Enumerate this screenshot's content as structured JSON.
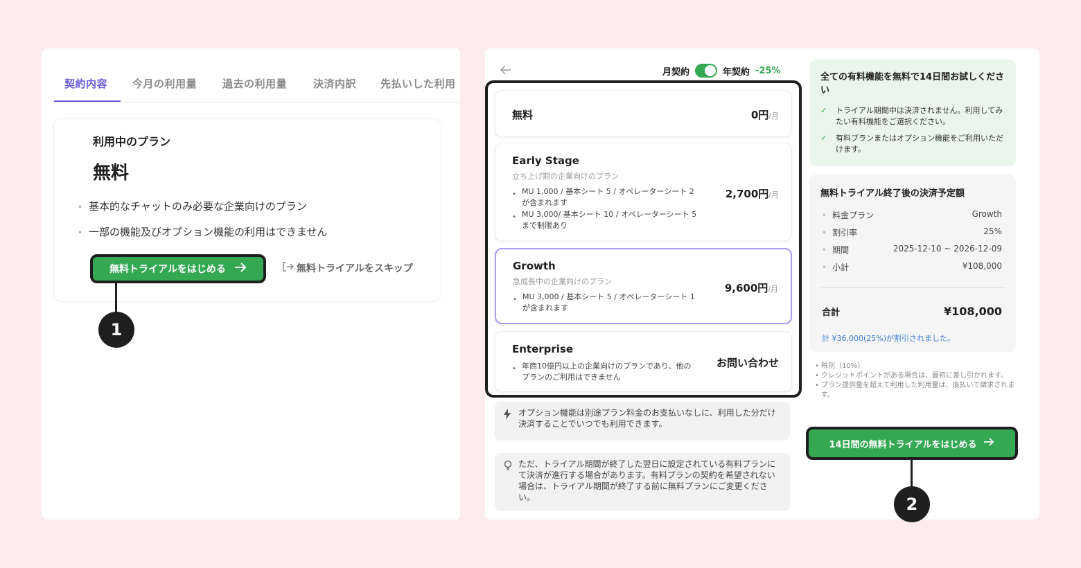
{
  "left": {
    "tabs": [
      "契約内容",
      "今月の利用量",
      "過去の利用量",
      "決済内訳",
      "先払いした利用"
    ],
    "plan_label": "利用中のプラン",
    "plan_name": "無料",
    "bullets": [
      "基本的なチャットのみ必要な企業向けのプラン",
      "一部の機能及びオプション機能の利用はできません"
    ],
    "trial_button": "無料トライアルをはじめる",
    "skip_button": "無料トライアルをスキップ",
    "callout": "1"
  },
  "right": {
    "billing": {
      "monthly": "月契約",
      "yearly": "年契約",
      "discount": "-25%"
    },
    "plans": [
      {
        "name": "無料",
        "price": "0円",
        "unit": "/月"
      },
      {
        "name": "Early Stage",
        "subtitle": "立ち上げ期の企業向けのプラン",
        "features": [
          "MU 1,000 / 基本シート 5 / オペレーターシート 2が含まれます",
          "MU 3,000/ 基本シート 10 / オペレーターシート 5まで制限あり"
        ],
        "price": "2,700円",
        "unit": "/月"
      },
      {
        "name": "Growth",
        "subtitle": "急成長中の企業向けのプラン",
        "features": [
          "MU 3,000 / 基本シート 5 / オペレーターシート 1が含まれます"
        ],
        "price": "9,600円",
        "unit": "/月"
      },
      {
        "name": "Enterprise",
        "features": [
          "年商10億円以上の企業向けのプランであり、他のプランのご利用はできません"
        ],
        "price": "お問い合わせ"
      }
    ],
    "option_info": "オプション機能は別途プラン料金のお支払いなしに、利用した分だけ決済することでいつでも利用できます。",
    "trial_info": "ただ、トライアル期間が終了した翌日に設定されている有料プランにて決済が進行する場合があります。有料プランの契約を希望されない場合は、トライアル期間が終了する前に無料プランにご変更ください。",
    "trial_box": {
      "title": "全ての有料機能を無料で14日間お試しください",
      "items": [
        "トライアル期間中は決済されません。利用してみたい有料機能をご選択ください。",
        "有料プランまたはオプション機能をご利用いただけます。"
      ]
    },
    "summary": {
      "title": "無料トライアル終了後の決済予定額",
      "rows": [
        {
          "k": "料金プラン",
          "v": "Growth"
        },
        {
          "k": "割引率",
          "v": "25%"
        },
        {
          "k": "期間",
          "v": "2025-12-10 ~ 2026-12-09"
        },
        {
          "k": "小計",
          "v": "¥108,000"
        }
      ],
      "total_label": "合計",
      "total_value": "¥108,000",
      "discount_note": "計 ¥36,000(25%)が割引されました。"
    },
    "notes": [
      "税別（10%）",
      "クレジットポイントがある場合は、最初に差し引かれます。",
      "プラン提供量を超えて利用した利用量は、後払いで請求されます。"
    ],
    "start_button": "14日間の無料トライアルをはじめる",
    "callout": "2"
  },
  "colors": {
    "accent": "#6a5ae0",
    "green": "#34a853",
    "background": "#fdecee",
    "link": "#3b7fd6"
  }
}
